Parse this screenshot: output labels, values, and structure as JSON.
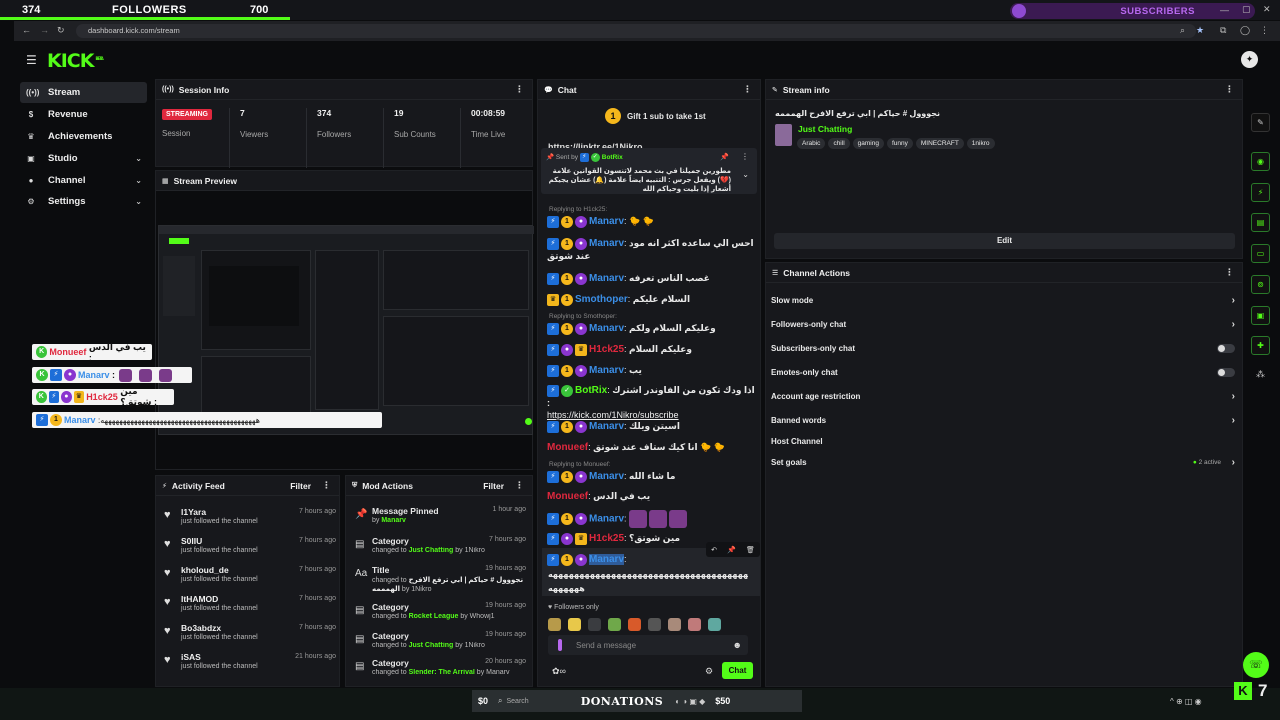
{
  "top_bar": {
    "followers_left": "374",
    "followers_label": "FOLLOWERS",
    "followers_goal": "700",
    "subscribers_label": "SUBSCRIBERS"
  },
  "browser": {
    "url": "dashboard.kick.com/stream"
  },
  "brand": {
    "logo": "KICK",
    "logo_sup": "BETA",
    "accent": "#53fc18"
  },
  "sidebar": {
    "items": [
      {
        "label": "Stream",
        "icon": "broadcast-icon"
      },
      {
        "label": "Revenue",
        "icon": "dollar-icon"
      },
      {
        "label": "Achievements",
        "icon": "trophy-icon"
      },
      {
        "label": "Studio",
        "icon": "camera-icon"
      },
      {
        "label": "Channel",
        "icon": "user-icon"
      },
      {
        "label": "Settings",
        "icon": "gear-icon"
      }
    ]
  },
  "session_info": {
    "title": "Session Info",
    "status_badge": "STREAMING",
    "status_label": "Session",
    "stats": [
      {
        "value": "7",
        "label": "Viewers"
      },
      {
        "value": "374",
        "label": "Followers"
      },
      {
        "value": "19",
        "label": "Sub Counts"
      },
      {
        "value": "00:08:59",
        "label": "Time Live"
      }
    ]
  },
  "stream_preview": {
    "title": "Stream Preview"
  },
  "overlay_chat": [
    {
      "user": "Monueef",
      "text": "يب في الدس :"
    },
    {
      "user": "Manarv",
      "text": ":"
    },
    {
      "user": "H1ck25",
      "text": "مين شوتق؟ :"
    },
    {
      "user": "Manarv",
      "text": ":ههههههههههههههههههههههههههههههههههههههههههه"
    }
  ],
  "activity_feed": {
    "title": "Activity Feed",
    "filter_label": "Filter",
    "rows": [
      {
        "name": "l1Yara",
        "sub": "just followed the channel",
        "time": "7 hours ago"
      },
      {
        "name": "S0IIU",
        "sub": "just followed the channel",
        "time": "7 hours ago"
      },
      {
        "name": "kholoud_de",
        "sub": "just followed the channel",
        "time": "7 hours ago"
      },
      {
        "name": "ItHAMOD",
        "sub": "just followed the channel",
        "time": "7 hours ago"
      },
      {
        "name": "Bo3abdzx",
        "sub": "just followed the channel",
        "time": "7 hours ago"
      },
      {
        "name": "iSAS",
        "sub": "just followed the channel",
        "time": "21 hours ago"
      }
    ]
  },
  "mod_actions": {
    "title": "Mod Actions",
    "filter_label": "Filter",
    "rows": [
      {
        "name": "Message Pinned",
        "pre": "by ",
        "hl": "Manarv",
        "post": "",
        "time": "1 hour ago",
        "icon": "pin-icon"
      },
      {
        "name": "Category",
        "pre": "changed to ",
        "hl": "Just Chatting",
        "post": " by 1Nikro",
        "time": "7 hours ago",
        "icon": "category-icon"
      },
      {
        "name": "Title",
        "pre": "changed to ",
        "hl": "نجووول # حياكم | ابي ترفع الافرح الهمممه",
        "post": " by 1Nikro",
        "time": "19 hours ago",
        "icon": "title-icon"
      },
      {
        "name": "Category",
        "pre": "changed to ",
        "hl": "Rocket League",
        "post": " by Whowj1",
        "time": "19 hours ago",
        "icon": "category-icon"
      },
      {
        "name": "Category",
        "pre": "changed to ",
        "hl": "Just Chatting",
        "post": " by 1Nikro",
        "time": "19 hours ago",
        "icon": "category-icon"
      },
      {
        "name": "Category",
        "pre": "changed to ",
        "hl": "Slender: The Arrival",
        "post": " by Manarv",
        "time": "20 hours ago",
        "icon": "category-icon"
      }
    ]
  },
  "chat": {
    "title": "Chat",
    "gift_text": "Gift 1 sub to take 1st",
    "pinned_link": "https://linktr.ee/1Nikro",
    "pinned_by_label": "Sent by",
    "pinned_by": "BotRix",
    "pinned_text": "مطورين جميلنا في بث محمد لاتنسون القوانين علامة (💔) ويفعل جرس : التنبيه ايضاً علامة (🔔) عشان يجيكم أشعار إذا بليت وحياكم الله",
    "lines": [
      {
        "reply": "Replying to H1ck25:",
        "user": "Manarv",
        "color": "#3b8fe8",
        "text": ":"
      },
      {
        "user": "Manarv",
        "color": "#3b8fe8",
        "text": "احس الي ساعده اكثر انه مود عند شوتق"
      },
      {
        "user": "Manarv",
        "color": "#3b8fe8",
        "text": "غصب الناس تعرفه"
      },
      {
        "user": "Smothoper",
        "color": "#3b8fe8",
        "text": "السلام عليكم"
      },
      {
        "reply": "Replying to Smothoper:",
        "user": "Manarv",
        "color": "#3b8fe8",
        "text": "وعليكم السلام ولكم"
      },
      {
        "user": "H1ck25",
        "color": "#e0283e",
        "text": "وعليكم السلام"
      },
      {
        "user": "Manarv",
        "color": "#3b8fe8",
        "text": "يب"
      },
      {
        "user": "BotRix",
        "color": "#53fc18",
        "text": "اذا ودك تكون من الفاوندر اشترك :",
        "link": "https://kick.com/1Nikro/subscribe"
      },
      {
        "user": "Manarv",
        "color": "#3b8fe8",
        "text": "اسيتن ويلك"
      },
      {
        "user": "Monueef",
        "color": "#e0283e",
        "text": "انا كيك ستاف عند شوتق"
      },
      {
        "reply": "Replying to Monueef:",
        "user": "Manarv",
        "color": "#3b8fe8",
        "text": "ما شاء الله"
      },
      {
        "user": "Monueef",
        "color": "#e0283e",
        "text": "يب في الدس"
      },
      {
        "user": "Manarv",
        "color": "#3b8fe8",
        "text": ":"
      },
      {
        "user": "H1ck25",
        "color": "#e0283e",
        "text": "مين شوتق؟"
      },
      {
        "user": "Manarv",
        "color": "#3b8fe8",
        "text": ":"
      }
    ],
    "last_line_text": "ههههههههههههههههههههههههههههههههههههههههههههههه",
    "last_line_text2": "ههههههه",
    "followers_only": "Followers only",
    "input_placeholder": "Send a message",
    "send_label": "Chat"
  },
  "stream_info": {
    "title": "Stream info",
    "stream_title": "نجووول # حياكم | ابي ترفع الافرح الهمممه",
    "category": "Just Chatting",
    "tags": [
      "Arabic",
      "chill",
      "gaming",
      "funny",
      "MINECRAFT",
      "1nikro"
    ],
    "edit_label": "Edit"
  },
  "channel_actions": {
    "title": "Channel Actions",
    "rows": [
      {
        "label": "Slow mode",
        "kind": "arrow"
      },
      {
        "label": "Followers-only chat",
        "kind": "arrow"
      },
      {
        "label": "Subscribers-only chat",
        "kind": "toggle"
      },
      {
        "label": "Emotes-only chat",
        "kind": "toggle"
      },
      {
        "label": "Account age restriction",
        "kind": "arrow"
      },
      {
        "label": "Banned words",
        "kind": "arrow"
      },
      {
        "label": "Host Channel",
        "kind": "none"
      },
      {
        "label": "Set goals",
        "kind": "arrow",
        "badge": "2 active"
      }
    ]
  },
  "taskbar": {
    "search_placeholder": "Search",
    "donations_label": "DONATIONS",
    "donation_left": "$0",
    "donation_right": "$50",
    "corner_number": "7"
  }
}
